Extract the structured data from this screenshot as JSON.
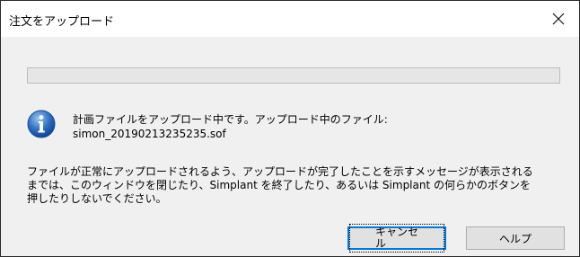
{
  "dialog": {
    "title": "注文をアップロード",
    "close_symbol": "✕"
  },
  "progress": {
    "fraction": 0.0
  },
  "message": {
    "line1": "計画ファイルをアップロード中です。アップロード中のファイル:",
    "line2": "simon_20190213235235.sof"
  },
  "notice": {
    "lines": [
      "ファイルが正常にアップロードされるよう、アップロードが完了したことを示すメッセージが表示される",
      "までは、このウィンドウを閉じたり、Simplant を終了したり、あるいは Simplant の何らかのボタンを",
      "押したりしないでください。"
    ]
  },
  "buttons": {
    "cancel": "キャンセル",
    "help": "ヘルプ"
  },
  "icons": {
    "info": "info-icon",
    "close": "close-icon"
  },
  "colors": {
    "dialog_bg": "#f0f0f0",
    "titlebar_bg": "#ffffff",
    "default_button_border": "#0078d7",
    "progress_track": "#e6e6e6"
  }
}
